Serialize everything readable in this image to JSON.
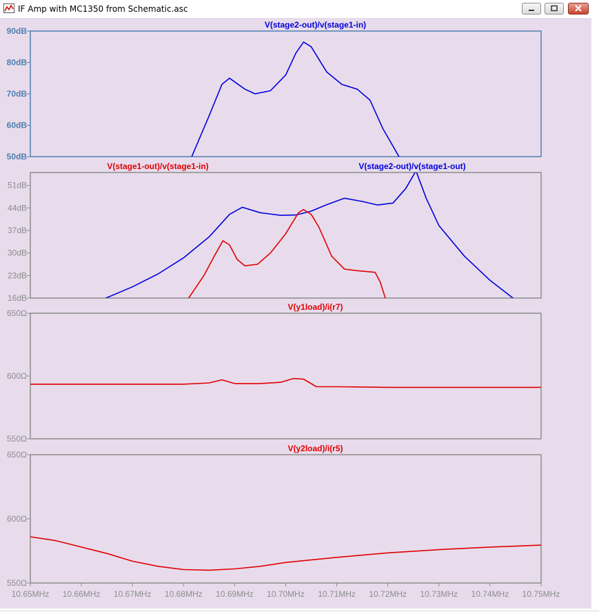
{
  "window": {
    "title": "IF Amp with MC1350 from Schematic.asc",
    "icons": [
      "waveform-app-icon",
      "minimize-icon",
      "maximize-icon",
      "close-icon"
    ]
  },
  "colors": {
    "background": "#e8dcec",
    "blue_trace": "#0000dd",
    "red_trace": "#e00000",
    "pane1_axis_label": "#4f7fb0",
    "gray_axis": "#8c8c8c"
  },
  "x_axis": {
    "tick_labels": [
      "10.65MHz",
      "10.66MHz",
      "10.67MHz",
      "10.68MHz",
      "10.69MHz",
      "10.70MHz",
      "10.71MHz",
      "10.72MHz",
      "10.73MHz",
      "10.74MHz",
      "10.75MHz"
    ]
  },
  "chart_data": [
    {
      "type": "line",
      "title": "V(stage2-out)/v(stage1-in)",
      "ylim": [
        50,
        90
      ],
      "y_ticks": [
        "90dB",
        "80dB",
        "70dB",
        "60dB",
        "50dB"
      ],
      "grid": false,
      "series": [
        {
          "name": "V(stage2-out)/v(stage1-in)",
          "color": "#0000dd",
          "x": [
            10.6816,
            10.685,
            10.6875,
            10.689,
            10.692,
            10.694,
            10.697,
            10.7,
            10.702,
            10.7035,
            10.705,
            10.708,
            10.711,
            10.714,
            10.7165,
            10.719,
            10.722,
            10.7225
          ],
          "y": [
            50,
            63,
            73,
            75,
            71.5,
            70,
            71,
            76,
            83,
            86.5,
            85,
            77,
            73,
            71.5,
            68,
            59,
            50.5,
            49
          ]
        }
      ]
    },
    {
      "type": "line",
      "title": "",
      "ylim": [
        16,
        55
      ],
      "y_ticks": [
        "51dB",
        "44dB",
        "37dB",
        "30dB",
        "23dB",
        "16dB"
      ],
      "legend": [
        {
          "text": "V(stage1-out)/v(stage1-in)",
          "color": "#e00000"
        },
        {
          "text": "V(stage2-out)/v(stage1-out)",
          "color": "#0000dd"
        }
      ],
      "series": [
        {
          "name": "V(stage2-out)/v(stage1-out)",
          "color": "#0000dd",
          "x": [
            10.6648,
            10.67,
            10.675,
            10.68,
            10.685,
            10.689,
            10.6915,
            10.695,
            10.699,
            10.702,
            10.705,
            10.708,
            10.7115,
            10.715,
            10.718,
            10.721,
            10.7235,
            10.7255,
            10.7275,
            10.73,
            10.735,
            10.74,
            10.7445
          ],
          "y": [
            16,
            19.5,
            23.5,
            28.5,
            35,
            42,
            44.2,
            42.5,
            41.7,
            41.8,
            43,
            45,
            47,
            46,
            44.9,
            45.5,
            50,
            55.5,
            47,
            38.5,
            29,
            21.5,
            16
          ]
        },
        {
          "name": "V(stage1-out)/v(stage1-in)",
          "color": "#e00000",
          "x": [
            10.681,
            10.684,
            10.686,
            10.6877,
            10.689,
            10.6905,
            10.692,
            10.6945,
            10.697,
            10.7,
            10.7025,
            10.7035,
            10.705,
            10.7065,
            10.709,
            10.7115,
            10.714,
            10.7175,
            10.7185,
            10.7195
          ],
          "y": [
            16,
            23,
            29,
            33.8,
            32.5,
            28,
            26,
            26.5,
            30,
            36,
            42.5,
            43.5,
            42,
            38,
            29,
            25,
            24.5,
            24,
            21,
            16
          ]
        }
      ]
    },
    {
      "type": "line",
      "title": "V(y1load)/i(r7)",
      "ylim": [
        550,
        650
      ],
      "y_ticks": [
        "650Ω",
        "600Ω",
        "550Ω"
      ],
      "series": [
        {
          "name": "V(y1load)/i(r7)",
          "color": "#e00000",
          "x": [
            10.65,
            10.66,
            10.67,
            10.68,
            10.685,
            10.6875,
            10.69,
            10.695,
            10.699,
            10.7015,
            10.7035,
            10.706,
            10.71,
            10.72,
            10.73,
            10.74,
            10.75
          ],
          "y": [
            593.5,
            593.5,
            593.5,
            593.5,
            594.5,
            597,
            594,
            594,
            595,
            598,
            597.5,
            591.5,
            591.5,
            591,
            591,
            591,
            591
          ]
        }
      ]
    },
    {
      "type": "line",
      "title": "V(y2load)/i(r5)",
      "ylim": [
        550,
        650
      ],
      "y_ticks": [
        "650Ω",
        "600Ω",
        "550Ω"
      ],
      "series": [
        {
          "name": "V(y2load)/i(r5)",
          "color": "#e00000",
          "x": [
            10.65,
            10.655,
            10.66,
            10.665,
            10.67,
            10.675,
            10.68,
            10.685,
            10.69,
            10.695,
            10.7,
            10.71,
            10.72,
            10.73,
            10.74,
            10.75
          ],
          "y": [
            586,
            583,
            578,
            573,
            567,
            563,
            560.5,
            560,
            561,
            563,
            566,
            570,
            573.5,
            576,
            578,
            579.5
          ]
        }
      ]
    }
  ]
}
